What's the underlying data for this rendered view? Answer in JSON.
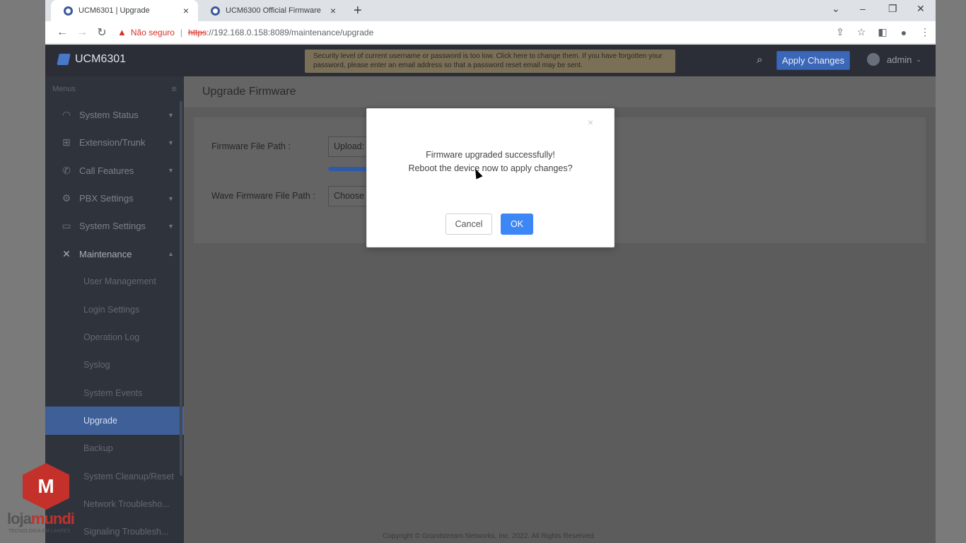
{
  "browser": {
    "tabs": [
      {
        "title": "UCM6301 | Upgrade",
        "active": true
      },
      {
        "title": "UCM6300 Official Firmware",
        "active": false
      }
    ],
    "new_tab_icon": "+",
    "security_label": "Não seguro",
    "url_scheme": "https",
    "url_rest": "://192.168.0.158:8089/maintenance/upgrade"
  },
  "app": {
    "logo_text": "UCM6301",
    "security_warning": "Security level of current username or password is too low. Click here to change them. If you have forgotten your password, please enter an email address so that a password reset email may be sent.",
    "apply_changes": "Apply Changes",
    "user": "admin"
  },
  "sidebar": {
    "header": "Menus",
    "items": [
      {
        "label": "System Status",
        "icon": "gauge-icon"
      },
      {
        "label": "Extension/Trunk",
        "icon": "network-icon"
      },
      {
        "label": "Call Features",
        "icon": "phone-icon"
      },
      {
        "label": "PBX Settings",
        "icon": "gear-icon"
      },
      {
        "label": "System Settings",
        "icon": "monitor-gear-icon"
      },
      {
        "label": "Maintenance",
        "icon": "tools-icon"
      }
    ],
    "sub_items": [
      "User Management",
      "Login Settings",
      "Operation Log",
      "Syslog",
      "System Events",
      "Upgrade",
      "Backup",
      "System Cleanup/Reset",
      "Network Troublesho...",
      "Signaling Troublesh..."
    ]
  },
  "page": {
    "title": "Upgrade Firmware",
    "firmware_label": "Firmware File Path :",
    "firmware_value": "Upload:",
    "wave_label": "Wave Firmware File Path :",
    "wave_value": "Choose",
    "copyright": "Copyright © Grandstream Networks, Inc. 2022. All Rights Reserved."
  },
  "modal": {
    "line1": "Firmware upgraded successfully!",
    "line2": "Reboot the device now to apply changes?",
    "cancel": "Cancel",
    "ok": "OK",
    "close_icon": "×"
  },
  "watermark": {
    "loja": "loja",
    "mundi": "mundi",
    "sub": "TECNOLOGIA EM LANTES"
  }
}
